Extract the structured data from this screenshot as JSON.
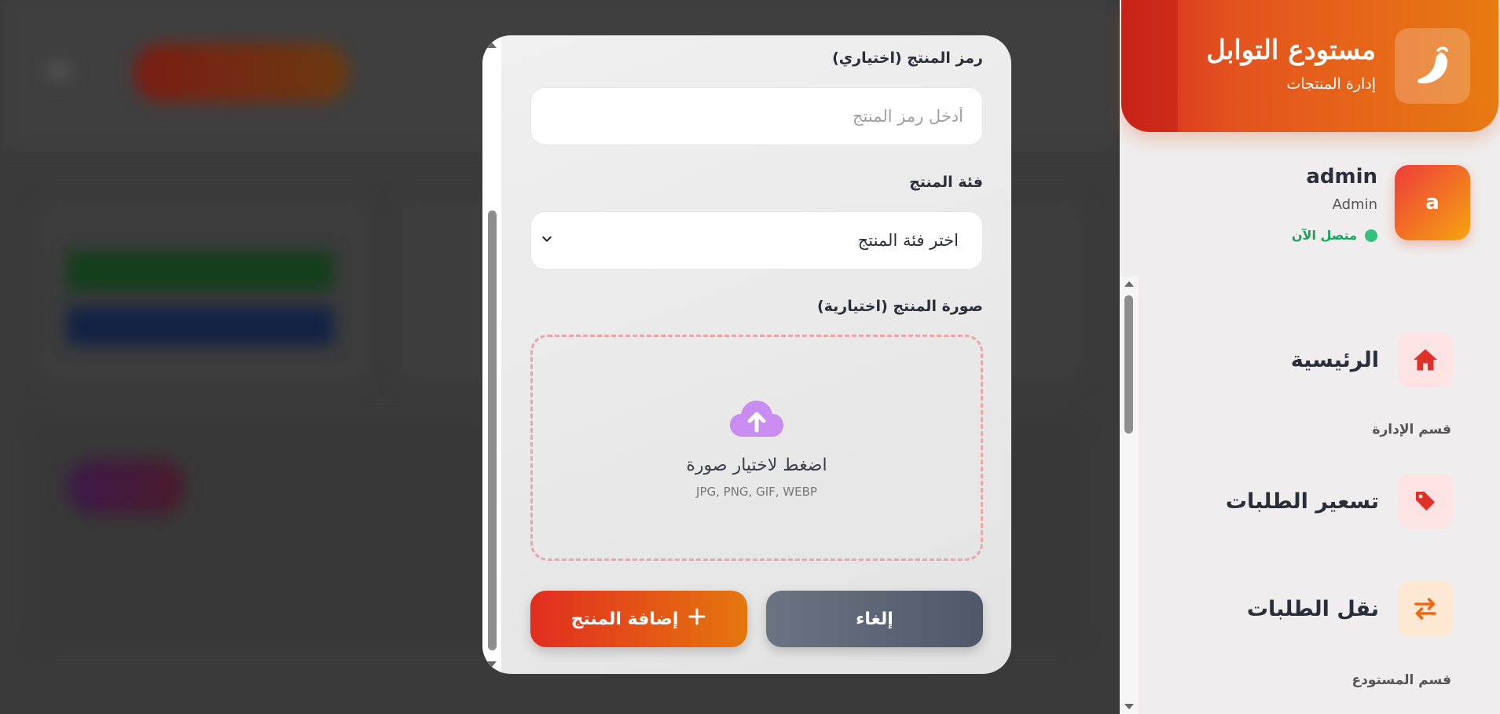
{
  "brand": {
    "title": "مستودع التوابل",
    "subtitle": "إدارة المنتجات",
    "icon": "chili-pepper-icon"
  },
  "user": {
    "initial": "a",
    "name": "admin",
    "role": "Admin",
    "status": "متصل الآن"
  },
  "nav": {
    "home": "الرئيسية",
    "section_admin": "قسم الإدارة",
    "pricing": "تسعير الطلبات",
    "transfer": "نقل الطلبات",
    "section_warehouse": "قسم المستودع"
  },
  "form": {
    "code_label": "رمز المنتج (اختياري)",
    "code_placeholder": "أدخل رمز المنتج",
    "category_label": "فئة المنتج",
    "category_selected": "اختر فئة المنتج",
    "image_label": "صورة المنتج (اختيارية)",
    "upload_text": "اضغط لاختيار صورة",
    "upload_formats": "JPG, PNG, GIF, WEBP",
    "add_button": "إضافة المنتج",
    "cancel_button": "إلغاء"
  },
  "colors": {
    "accent_red": "#e22d20",
    "accent_orange": "#e5770e",
    "upload_icon": "#c98cf0",
    "online": "#18a35d"
  }
}
